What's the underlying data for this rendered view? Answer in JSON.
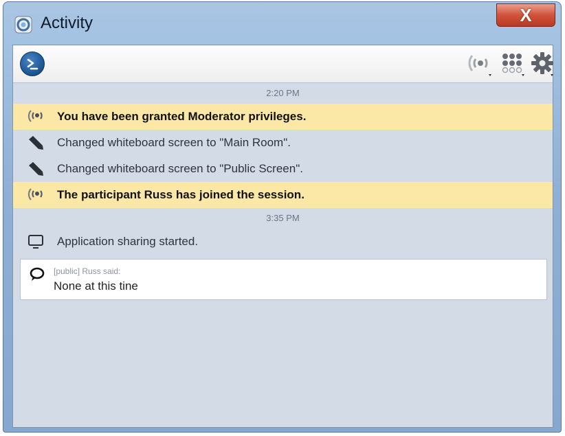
{
  "window": {
    "title": "Activity",
    "close_label": "X"
  },
  "toolbar": {
    "icons": [
      "console-icon",
      "broadcast-icon",
      "dot-grid-icon",
      "gear-icon"
    ]
  },
  "feed": {
    "groups": [
      {
        "time": "2:20 PM",
        "events": [
          {
            "icon": "broadcast-icon",
            "text": "You have been granted Moderator privileges.",
            "highlight": true
          },
          {
            "icon": "marker-icon",
            "text": "Changed whiteboard screen to \"Main Room\".",
            "highlight": false
          },
          {
            "icon": "marker-icon",
            "text": "Changed whiteboard screen to \"Public Screen\".",
            "highlight": false
          },
          {
            "icon": "broadcast-icon",
            "text": "The participant Russ has joined the session.",
            "highlight": true
          }
        ]
      },
      {
        "time": "3:35 PM",
        "events": [
          {
            "icon": "monitor-icon",
            "text": "Application sharing started.",
            "highlight": false
          }
        ],
        "chat": {
          "icon": "speech-bubble-icon",
          "meta": "[public] Russ said:",
          "message": "None at this tine"
        }
      }
    ]
  },
  "colors": {
    "highlight": "#fbe8a6",
    "client_bg": "#d3dbe6",
    "close_red": "#c8452c"
  }
}
